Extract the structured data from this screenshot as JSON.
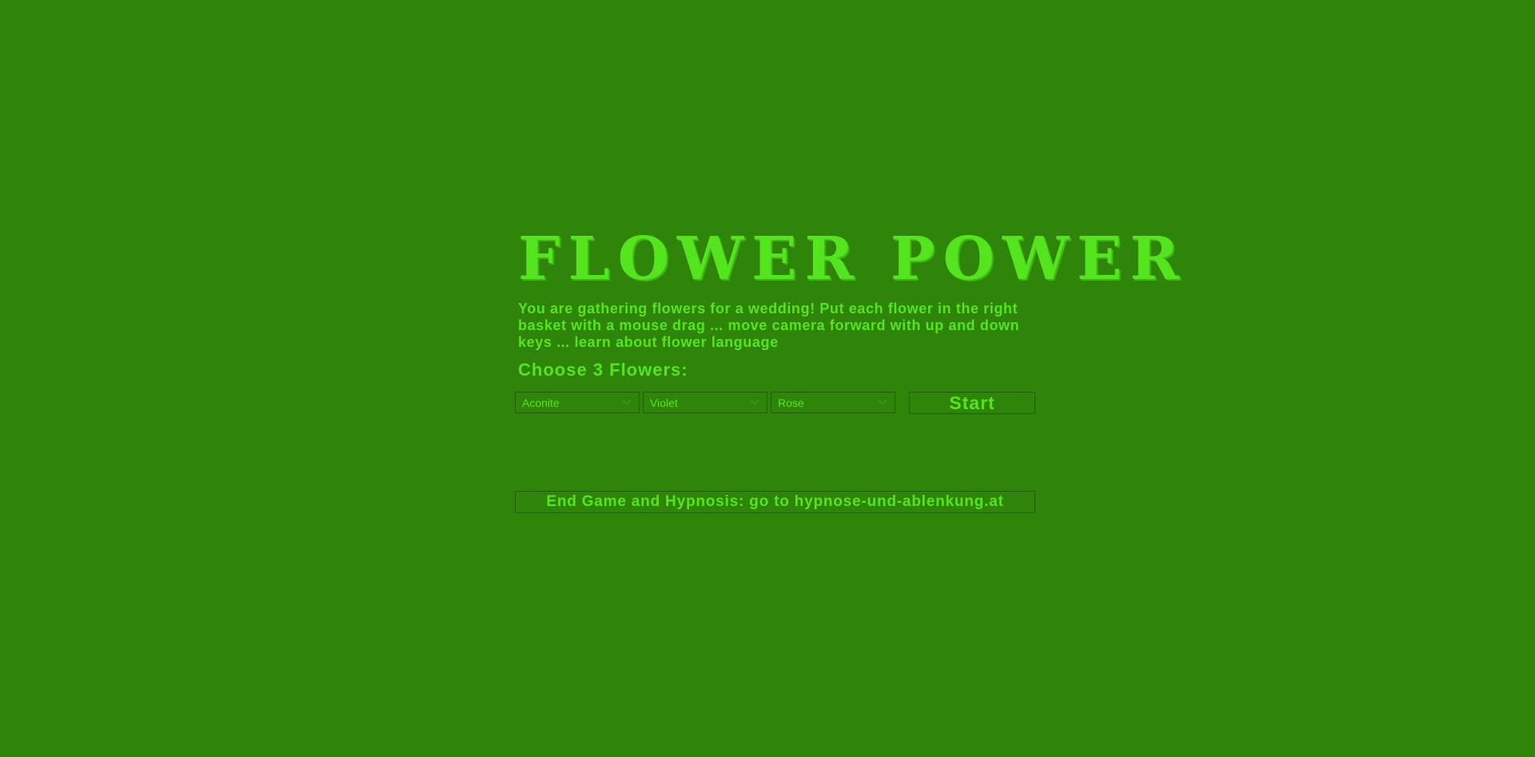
{
  "game": {
    "title": "FLOWER POWER",
    "intro": "You are gathering flowers for a wedding! Put each flower in the right basket with a mouse drag ... move camera forward with up and down keys ... learn about flower language",
    "choose_label": "Choose 3 Flowers:",
    "selects": [
      {
        "value": "Aconite"
      },
      {
        "value": "Violet"
      },
      {
        "value": "Rose"
      }
    ],
    "start_label": "Start",
    "end_label": "End Game and Hypnosis: go to hypnose-und-ablenkung.at"
  },
  "icons": {
    "dropdown": "chevron-down-icon"
  },
  "colors": {
    "background": "#2e8509",
    "text": "#55e51f",
    "border": "#1f5c06"
  }
}
